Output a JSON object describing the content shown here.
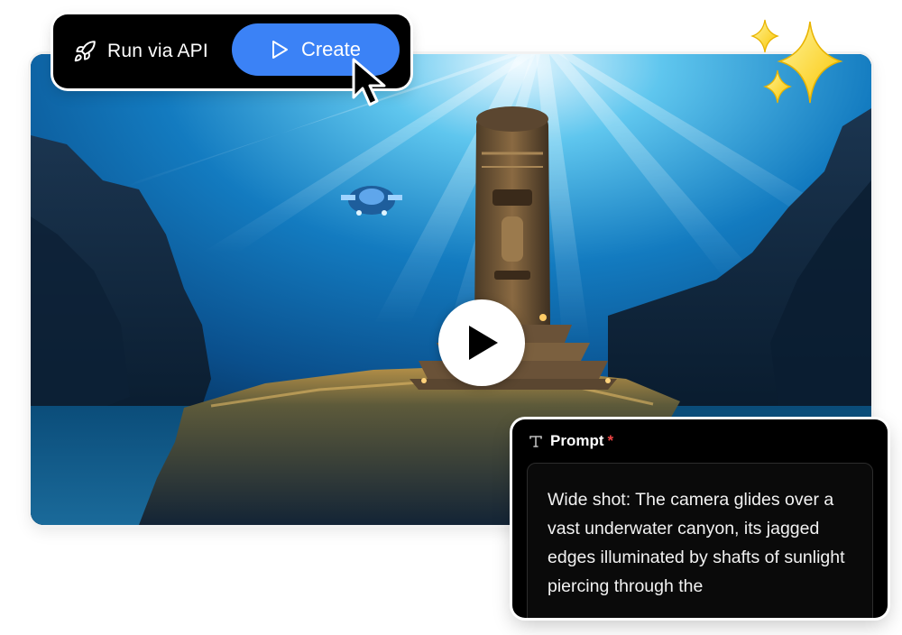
{
  "toolbar": {
    "api_label": "Run via API",
    "create_label": "Create",
    "icons": {
      "api": "rocket-icon",
      "create": "play-outline-icon"
    },
    "create_color": "#3b82f6"
  },
  "video": {
    "play_icon": "play-icon",
    "description_icons": [
      "sparkles-icon",
      "mouse-cursor-icon"
    ]
  },
  "prompt": {
    "icon": "text-type-icon",
    "label": "Prompt",
    "required_marker": "*",
    "required_color": "#ef4444",
    "value": "Wide shot: The camera glides over a vast underwater canyon, its jagged edges illuminated by shafts of sunlight piercing through the"
  }
}
